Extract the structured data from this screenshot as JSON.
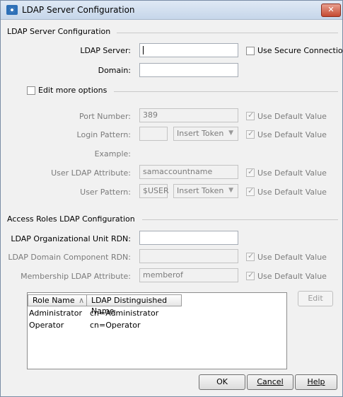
{
  "window": {
    "title": "LDAP Server Configuration",
    "close_label": "✕"
  },
  "server_section": {
    "title": "LDAP Server Configuration",
    "ldap_server_label": "LDAP Server:",
    "ldap_server_value": "",
    "secure_label": "Use Secure Connection",
    "domain_label": "Domain:",
    "domain_value": ""
  },
  "more_options": {
    "label": "Edit more options",
    "port_label": "Port Number:",
    "port_value": "389",
    "use_default": "Use Default Value",
    "login_pattern_label": "Login Pattern:",
    "login_pattern_value": "",
    "insert_token": "Insert Token",
    "example_label": "Example:",
    "user_attr_label": "User LDAP Attribute:",
    "user_attr_value": "samaccountname",
    "user_pattern_label": "User Pattern:",
    "user_pattern_value": "$USER"
  },
  "roles_section": {
    "title": "Access Roles LDAP Configuration",
    "ou_label": "LDAP Organizational Unit RDN:",
    "ou_value": "",
    "dc_label": "LDAP Domain Component RDN:",
    "dc_value": "",
    "membership_label": "Membership LDAP Attribute:",
    "membership_value": "memberof",
    "edit_label": "Edit"
  },
  "roles_table": {
    "columns": [
      "Role Name",
      "LDAP Distinguished Name"
    ],
    "sort_indicator": "∧",
    "rows": [
      [
        "Administrator",
        "cn=Administrator"
      ],
      [
        "Operator",
        "cn=Operator"
      ]
    ]
  },
  "buttons": {
    "ok": "OK",
    "cancel": "Cancel",
    "help": "Help"
  }
}
